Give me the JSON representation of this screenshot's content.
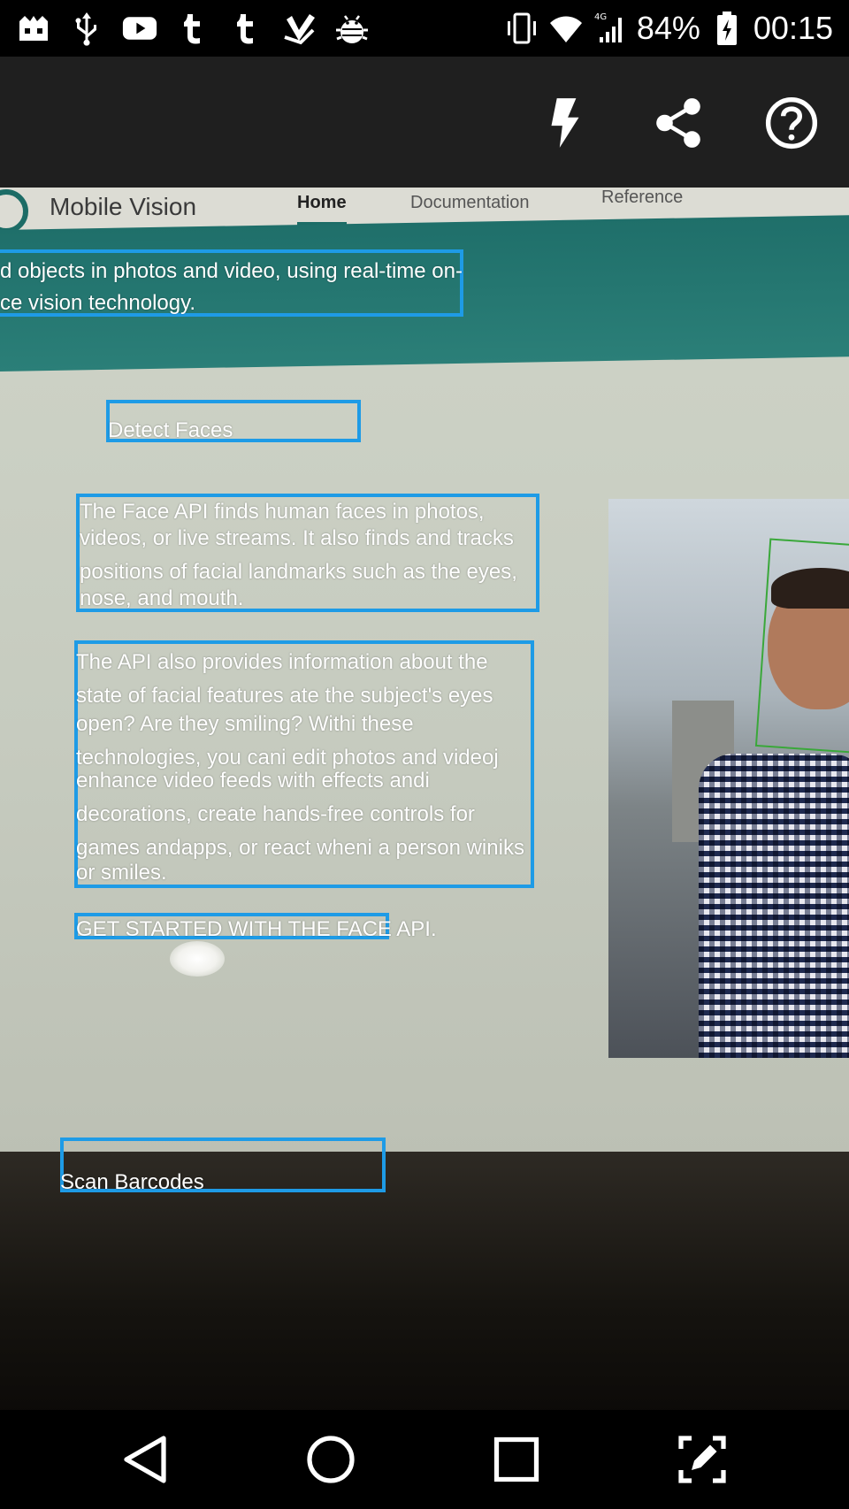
{
  "status_bar": {
    "notification_icons": [
      "game-controller-icon",
      "usb-icon",
      "youtube-icon",
      "tumblr-icon",
      "tumblr-icon",
      "checklist-icon",
      "android-debug-icon"
    ],
    "battery_percent": "84%",
    "time": "00:15",
    "network": "4G"
  },
  "toolbar": {
    "flash_icon": "flash-icon",
    "share_icon": "share-icon",
    "help_icon": "help-icon"
  },
  "scene": {
    "site_title": "Mobile Vision",
    "tabs": [
      "Home",
      "Documentation",
      "Reference"
    ]
  },
  "ocr_blocks": [
    {
      "lines": [
        "d objects in photos and video, using real-time on-",
        "ce vision technology."
      ]
    },
    {
      "lines": [
        "Detect Faces"
      ]
    },
    {
      "lines": [
        "The Face API finds human faces in photos,",
        " videos, or live streams. It also finds and tracks",
        " positions of facial landmarks such as the eyes,",
        "nose, and mouth."
      ]
    },
    {
      "lines": [
        "The API also provides information about the",
        "state of facial features ate the subject's eyes",
        " open? Are they smiling? Withi these",
        "technologies, you cani edit photos and videoj",
        "   enhance video feeds with effects andi",
        "  decorations, create hands-free controls for",
        "   games andapps, or react wheni a person winiks",
        "or smiles."
      ]
    },
    {
      "lines": [
        "GET STARTED WITH THE FACE API."
      ]
    },
    {
      "lines": [
        "Scan Barcodes"
      ]
    }
  ],
  "nav_bar": {
    "back_icon": "back-icon",
    "home_icon": "home-icon",
    "recents_icon": "recents-icon",
    "screenshot_edit_icon": "screenshot-edit-icon"
  }
}
